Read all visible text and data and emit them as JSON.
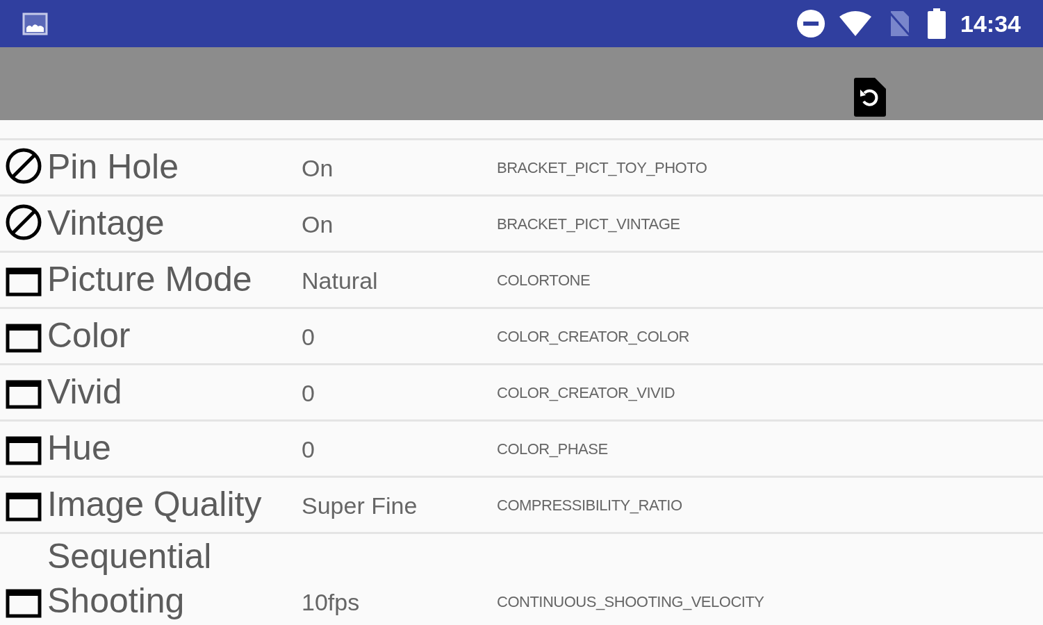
{
  "status_bar": {
    "time": "14:34"
  },
  "settings": [
    {
      "kind": "blocked",
      "label": "Pin Hole",
      "value": "On",
      "key": "BRACKET_PICT_TOY_PHOTO"
    },
    {
      "kind": "blocked",
      "label": "Vintage",
      "value": "On",
      "key": "BRACKET_PICT_VINTAGE"
    },
    {
      "kind": "window",
      "label": "Picture Mode",
      "value": "Natural",
      "key": "COLORTONE"
    },
    {
      "kind": "window",
      "label": "Color",
      "value": "0",
      "key": "COLOR_CREATOR_COLOR"
    },
    {
      "kind": "window",
      "label": "Vivid",
      "value": "0",
      "key": "COLOR_CREATOR_VIVID"
    },
    {
      "kind": "window",
      "label": "Hue",
      "value": "0",
      "key": "COLOR_PHASE"
    },
    {
      "kind": "window",
      "label": "Image Quality",
      "value": "Super Fine",
      "key": "COMPRESSIBILITY_RATIO"
    },
    {
      "kind": "window",
      "label": "Sequential Shooting",
      "value": "10fps",
      "key": "CONTINUOUS_SHOOTING_VELOCITY"
    }
  ]
}
